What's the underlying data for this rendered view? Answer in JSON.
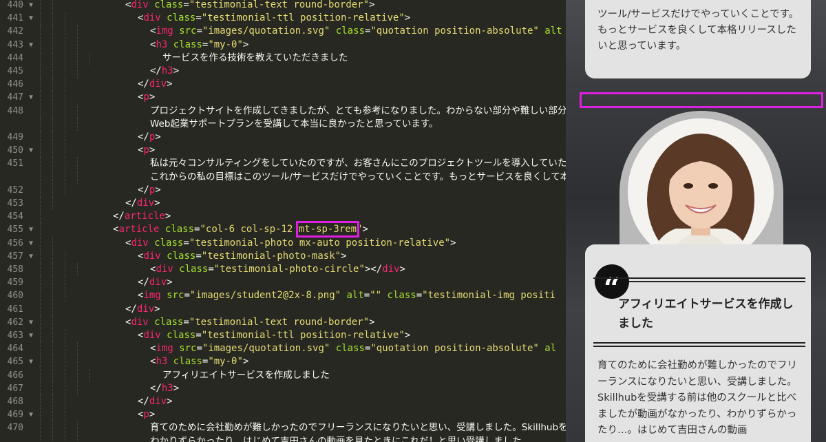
{
  "editor": {
    "lines": [
      {
        "n": "440",
        "fold": true,
        "indent": 2,
        "tokens": [
          [
            "p",
            "<"
          ],
          [
            "t",
            "div"
          ],
          [
            "p",
            " "
          ],
          [
            "a",
            "class"
          ],
          [
            "p",
            "="
          ],
          [
            "s",
            "\"testimonial-text round-border\""
          ],
          [
            "p",
            ">"
          ]
        ]
      },
      {
        "n": "441",
        "fold": true,
        "indent": 3,
        "tokens": [
          [
            "p",
            "<"
          ],
          [
            "t",
            "div"
          ],
          [
            "p",
            " "
          ],
          [
            "a",
            "class"
          ],
          [
            "p",
            "="
          ],
          [
            "s",
            "\"testimonial-ttl position-relative\""
          ],
          [
            "p",
            ">"
          ]
        ]
      },
      {
        "n": "442",
        "fold": false,
        "indent": 4,
        "tokens": [
          [
            "p",
            "<"
          ],
          [
            "t",
            "img"
          ],
          [
            "p",
            " "
          ],
          [
            "a",
            "src"
          ],
          [
            "p",
            "="
          ],
          [
            "s",
            "\"images/quotation.svg\""
          ],
          [
            "p",
            " "
          ],
          [
            "a",
            "class"
          ],
          [
            "p",
            "="
          ],
          [
            "s",
            "\"quotation position-absolute\""
          ],
          [
            "p",
            " "
          ],
          [
            "a",
            "alt"
          ]
        ]
      },
      {
        "n": "443",
        "fold": true,
        "indent": 4,
        "tokens": [
          [
            "p",
            "<"
          ],
          [
            "t",
            "h3"
          ],
          [
            "p",
            " "
          ],
          [
            "a",
            "class"
          ],
          [
            "p",
            "="
          ],
          [
            "s",
            "\"my-0\""
          ],
          [
            "p",
            ">"
          ]
        ]
      },
      {
        "n": "444",
        "fold": false,
        "indent": 5,
        "tokens": [
          [
            "x",
            "サービスを作る技術を教えていただきました"
          ]
        ]
      },
      {
        "n": "445",
        "fold": false,
        "indent": 4,
        "tokens": [
          [
            "p",
            "</"
          ],
          [
            "t",
            "h3"
          ],
          [
            "p",
            ">"
          ]
        ]
      },
      {
        "n": "446",
        "fold": false,
        "indent": 3,
        "tokens": [
          [
            "p",
            "</"
          ],
          [
            "t",
            "div"
          ],
          [
            "p",
            ">"
          ]
        ]
      },
      {
        "n": "447",
        "fold": true,
        "indent": 3,
        "tokens": [
          [
            "p",
            "<"
          ],
          [
            "t",
            "p"
          ],
          [
            "p",
            ">"
          ]
        ]
      },
      {
        "n": "448",
        "fold": false,
        "indent": 4,
        "tokens": [
          [
            "x",
            "プロジェクトサイトを作成してきましたが、とても参考になりました。わからない部分や難しい部分はコー"
          ]
        ]
      },
      {
        "n": "",
        "fold": false,
        "indent": 4,
        "tokens": [
          [
            "x",
            "Web起業サポートプランを受講して本当に良かったと思っています。"
          ]
        ]
      },
      {
        "n": "449",
        "fold": false,
        "indent": 3,
        "tokens": [
          [
            "p",
            "</"
          ],
          [
            "t",
            "p"
          ],
          [
            "p",
            ">"
          ]
        ]
      },
      {
        "n": "450",
        "fold": true,
        "indent": 3,
        "tokens": [
          [
            "p",
            "<"
          ],
          [
            "t",
            "p"
          ],
          [
            "p",
            ">"
          ]
        ]
      },
      {
        "n": "451",
        "fold": false,
        "indent": 4,
        "tokens": [
          [
            "x",
            "私は元々コンサルティングをしていたのですが、お客さんにこのプロジェクトツールを導入していただき、御"
          ]
        ]
      },
      {
        "n": "",
        "fold": false,
        "indent": 4,
        "tokens": [
          [
            "x",
            "これからの私の目標はこのツール/サービスだけでやっていくことです。もっとサービスを良くして本格リリー"
          ]
        ]
      },
      {
        "n": "452",
        "fold": false,
        "indent": 3,
        "tokens": [
          [
            "p",
            "</"
          ],
          [
            "t",
            "p"
          ],
          [
            "p",
            ">"
          ]
        ]
      },
      {
        "n": "453",
        "fold": false,
        "indent": 2,
        "tokens": [
          [
            "p",
            "</"
          ],
          [
            "t",
            "div"
          ],
          [
            "p",
            ">"
          ]
        ]
      },
      {
        "n": "454",
        "fold": false,
        "indent": 1,
        "tokens": [
          [
            "p",
            "</"
          ],
          [
            "t",
            "article"
          ],
          [
            "p",
            ">"
          ]
        ]
      },
      {
        "n": "455",
        "fold": true,
        "indent": 1,
        "tokens": [
          [
            "p",
            "<"
          ],
          [
            "t",
            "article"
          ],
          [
            "p",
            " "
          ],
          [
            "a",
            "class"
          ],
          [
            "p",
            "="
          ],
          [
            "s",
            "\"col-6 col-sp-12 "
          ],
          [
            "s",
            "mt-sp-3rem",
            "hl"
          ],
          [
            "s",
            "\""
          ],
          [
            "p",
            ">"
          ]
        ]
      },
      {
        "n": "456",
        "fold": true,
        "indent": 2,
        "tokens": [
          [
            "p",
            "<"
          ],
          [
            "t",
            "div"
          ],
          [
            "p",
            " "
          ],
          [
            "a",
            "class"
          ],
          [
            "p",
            "="
          ],
          [
            "s",
            "\"testimonial-photo mx-auto position-relative\""
          ],
          [
            "p",
            ">"
          ]
        ]
      },
      {
        "n": "457",
        "fold": true,
        "indent": 3,
        "tokens": [
          [
            "p",
            "<"
          ],
          [
            "t",
            "div"
          ],
          [
            "p",
            " "
          ],
          [
            "a",
            "class"
          ],
          [
            "p",
            "="
          ],
          [
            "s",
            "\"testimonial-photo-mask\""
          ],
          [
            "p",
            ">"
          ]
        ]
      },
      {
        "n": "458",
        "fold": false,
        "indent": 4,
        "tokens": [
          [
            "p",
            "<"
          ],
          [
            "t",
            "div"
          ],
          [
            "p",
            " "
          ],
          [
            "a",
            "class"
          ],
          [
            "p",
            "="
          ],
          [
            "s",
            "\"testimonial-photo-circle\""
          ],
          [
            "p",
            "></"
          ],
          [
            "t",
            "div"
          ],
          [
            "p",
            ">"
          ]
        ]
      },
      {
        "n": "459",
        "fold": false,
        "indent": 3,
        "tokens": [
          [
            "p",
            "</"
          ],
          [
            "t",
            "div"
          ],
          [
            "p",
            ">"
          ]
        ]
      },
      {
        "n": "460",
        "fold": false,
        "indent": 3,
        "tokens": [
          [
            "p",
            "<"
          ],
          [
            "t",
            "img"
          ],
          [
            "p",
            " "
          ],
          [
            "a",
            "src"
          ],
          [
            "p",
            "="
          ],
          [
            "s",
            "\"images/student2@2x-8.png\""
          ],
          [
            "p",
            " "
          ],
          [
            "a",
            "alt"
          ],
          [
            "p",
            "="
          ],
          [
            "s",
            "\"\""
          ],
          [
            "p",
            " "
          ],
          [
            "a",
            "class"
          ],
          [
            "p",
            "="
          ],
          [
            "s",
            "\"testimonial-img positi"
          ]
        ]
      },
      {
        "n": "461",
        "fold": false,
        "indent": 2,
        "tokens": [
          [
            "p",
            "</"
          ],
          [
            "t",
            "div"
          ],
          [
            "p",
            ">"
          ]
        ]
      },
      {
        "n": "462",
        "fold": true,
        "indent": 2,
        "tokens": [
          [
            "p",
            "<"
          ],
          [
            "t",
            "div"
          ],
          [
            "p",
            " "
          ],
          [
            "a",
            "class"
          ],
          [
            "p",
            "="
          ],
          [
            "s",
            "\"testimonial-text round-border\""
          ],
          [
            "p",
            ">"
          ]
        ]
      },
      {
        "n": "463",
        "fold": true,
        "indent": 3,
        "tokens": [
          [
            "p",
            "<"
          ],
          [
            "t",
            "div"
          ],
          [
            "p",
            " "
          ],
          [
            "a",
            "class"
          ],
          [
            "p",
            "="
          ],
          [
            "s",
            "\"testimonial-ttl position-relative\""
          ],
          [
            "p",
            ">"
          ]
        ]
      },
      {
        "n": "464",
        "fold": false,
        "indent": 4,
        "tokens": [
          [
            "p",
            "<"
          ],
          [
            "t",
            "img"
          ],
          [
            "p",
            " "
          ],
          [
            "a",
            "src"
          ],
          [
            "p",
            "="
          ],
          [
            "s",
            "\"images/quotation.svg\""
          ],
          [
            "p",
            " "
          ],
          [
            "a",
            "class"
          ],
          [
            "p",
            "="
          ],
          [
            "s",
            "\"quotation position-absolute\""
          ],
          [
            "p",
            " "
          ],
          [
            "a",
            "al"
          ]
        ]
      },
      {
        "n": "465",
        "fold": true,
        "indent": 4,
        "tokens": [
          [
            "p",
            "<"
          ],
          [
            "t",
            "h3"
          ],
          [
            "p",
            " "
          ],
          [
            "a",
            "class"
          ],
          [
            "p",
            "="
          ],
          [
            "s",
            "\"my-0\""
          ],
          [
            "p",
            ">"
          ]
        ]
      },
      {
        "n": "466",
        "fold": false,
        "indent": 5,
        "tokens": [
          [
            "x",
            "アフィリエイトサービスを作成しました"
          ]
        ]
      },
      {
        "n": "467",
        "fold": false,
        "indent": 4,
        "tokens": [
          [
            "p",
            "</"
          ],
          [
            "t",
            "h3"
          ],
          [
            "p",
            ">"
          ]
        ]
      },
      {
        "n": "468",
        "fold": false,
        "indent": 3,
        "tokens": [
          [
            "p",
            "</"
          ],
          [
            "t",
            "div"
          ],
          [
            "p",
            ">"
          ]
        ]
      },
      {
        "n": "469",
        "fold": true,
        "indent": 3,
        "tokens": [
          [
            "p",
            "<"
          ],
          [
            "t",
            "p"
          ],
          [
            "p",
            ">"
          ]
        ]
      },
      {
        "n": "470",
        "fold": false,
        "indent": 4,
        "tokens": [
          [
            "x",
            "育てのために会社勤めが難しかったのでフリーランスになりたいと思い、受講しました。Skillhubを受"
          ]
        ]
      },
      {
        "n": "",
        "fold": false,
        "indent": 4,
        "tokens": [
          [
            "x",
            "わかりずらかったり…はじめて吉田さんの動画を見たときにこれだ！と思い受講しました"
          ]
        ]
      }
    ]
  },
  "preview": {
    "card1_text": "ツール/サービスだけでやっていくことです。もっとサービスを良くして本格リリースしたいと思っています。",
    "quote_mark": "“",
    "card2_title": "アフィリエイトサービスを作成しました",
    "card2_body": "育てのために会社勤めが難しかったのでフリーランスになりたいと思い、受講しました。Skillhubを受講する前は他のスクールと比べましたが動画がなかったり、わかりずらかったり…。はじめて吉田さんの動画"
  }
}
